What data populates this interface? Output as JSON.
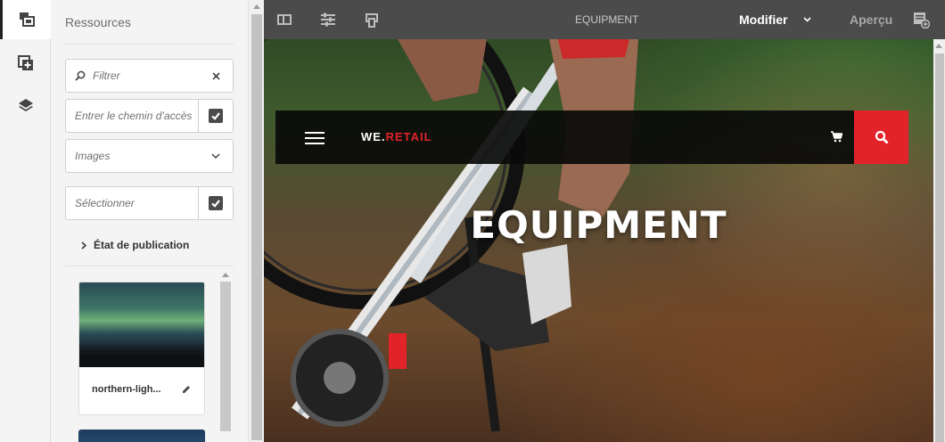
{
  "panel": {
    "title": "Ressources",
    "filter_placeholder": "Filtrer",
    "path_placeholder": "Entrer le chemin d’accès",
    "asset_type": "Images",
    "select_placeholder": "Sélectionner",
    "publication_state": "État de publication"
  },
  "assets": [
    {
      "name": "northern-ligh..."
    }
  ],
  "toolbar": {
    "page_title": "EQUIPMENT",
    "mode_label": "Modifier",
    "preview_label": "Aperçu"
  },
  "page": {
    "logo_prefix": "WE.",
    "logo_suffix": "RETAIL",
    "heading": "EQUIPMENT"
  },
  "colors": {
    "brand_red": "#e2232a",
    "toolbar_bg": "#4b4b4b"
  }
}
